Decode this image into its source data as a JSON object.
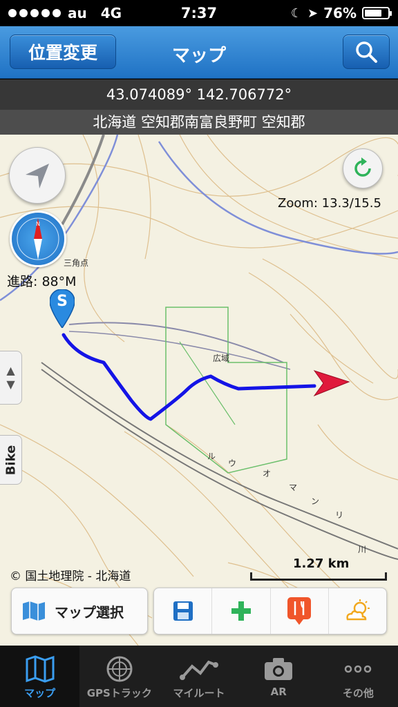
{
  "status_bar": {
    "carrier": "au",
    "network": "4G",
    "time": "7:37",
    "battery_percent_text": "76%",
    "battery_level": 0.76
  },
  "nav": {
    "title": "マップ",
    "left_button": "位置変更",
    "right_button_icon": "search-icon"
  },
  "location": {
    "coordinates": "43.074089° 142.706772°",
    "address": "北海道 空知郡南富良野町 空知郡"
  },
  "map": {
    "heading": "進路: 88°M",
    "zoom": "Zoom: 13.3/15.5",
    "start_marker": "S",
    "side_tab": "Bike",
    "attribution": "© 国土地理院 - 北海道",
    "scale": "1.27 km",
    "route_color": "#1414e6",
    "current_marker_color": "#e01a3c"
  },
  "map_toolbar": {
    "map_select_label": "マップ選択",
    "tools": [
      "save-icon",
      "add-icon",
      "restaurant-icon",
      "weather-icon"
    ]
  },
  "tabs": [
    {
      "label": "マップ",
      "icon": "map-icon",
      "active": true
    },
    {
      "label": "GPSトラック",
      "icon": "gps-track-icon",
      "active": false
    },
    {
      "label": "マイルート",
      "icon": "my-route-icon",
      "active": false
    },
    {
      "label": "AR",
      "icon": "camera-icon",
      "active": false
    },
    {
      "label": "その他",
      "icon": "more-icon",
      "active": false
    }
  ],
  "colors": {
    "nav_blue": "#2a7fd0",
    "active_tab": "#3a9df0"
  }
}
